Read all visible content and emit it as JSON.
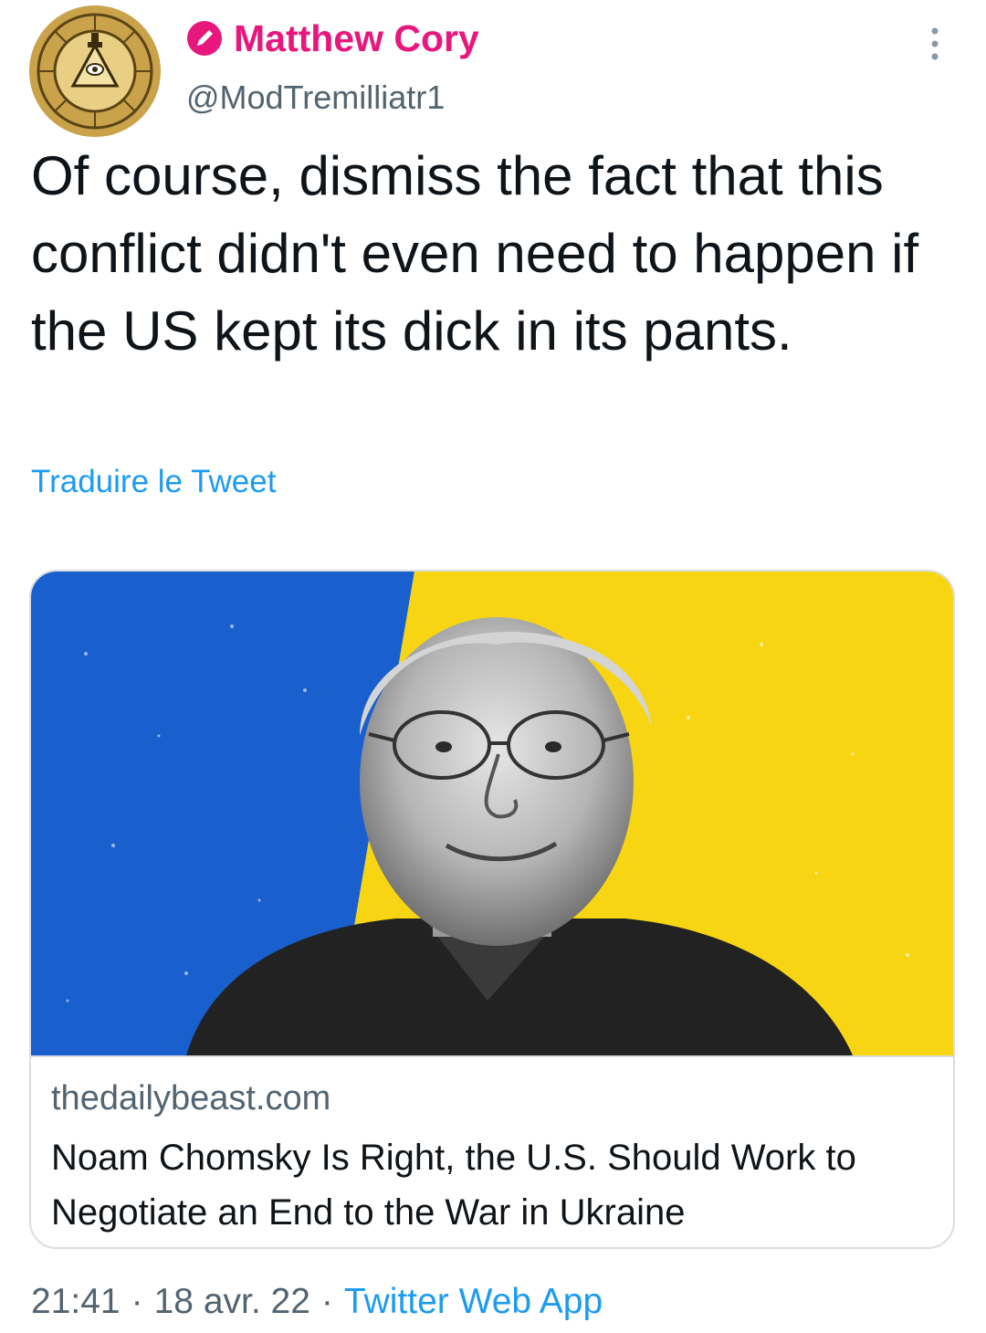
{
  "tweet": {
    "author": {
      "display_name": "Matthew Cory",
      "handle": "@ModTremilliatr1",
      "avatar_icon": "illuminati-wheel-avatar",
      "badge_icon": "pencil-badge-icon",
      "name_color": "#e8177d"
    },
    "text": "Of course, dismiss the fact that this conflict didn't even need to happen if the US kept its dick in its pants.",
    "translate_label": "Traduire le Tweet",
    "more_icon": "more-vertical-icon",
    "card": {
      "image_description_icon": "portrait-image",
      "image_colors": {
        "left_blue": "#1a5fce",
        "right_yellow": "#f7d513"
      },
      "domain": "thedailybeast.com",
      "title": "Noam Chomsky Is Right, the U.S. Should Work to Negotiate an End to the War in Ukraine"
    },
    "meta": {
      "time": "21:41",
      "separator": "·",
      "date": "18 avr. 22",
      "source": "Twitter Web App"
    }
  },
  "colors": {
    "link": "#1d9bf0",
    "secondary_text": "#536471",
    "primary_text": "#0f1419",
    "border": "#d9dee2"
  }
}
